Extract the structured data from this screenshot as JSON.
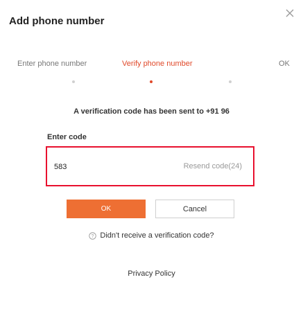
{
  "dialog": {
    "title": "Add phone number",
    "close_icon": "close-icon"
  },
  "steps": [
    {
      "label": "Enter phone number",
      "state": "done"
    },
    {
      "label": "Verify phone number",
      "state": "active"
    },
    {
      "label": "OK",
      "state": "pending"
    }
  ],
  "info_text": "A verification code has been sent to +91 96",
  "code": {
    "label": "Enter code",
    "value": "583",
    "resend_label": "Resend code(24)"
  },
  "actions": {
    "ok_label": "OK",
    "cancel_label": "Cancel"
  },
  "help": {
    "icon": "help-circle-icon",
    "text": "Didn't receive a verification code?"
  },
  "footer": {
    "privacy_label": "Privacy Policy"
  },
  "colors": {
    "accent": "#ee6f33",
    "active_step": "#e0492a",
    "highlight_border": "#e8102e"
  }
}
